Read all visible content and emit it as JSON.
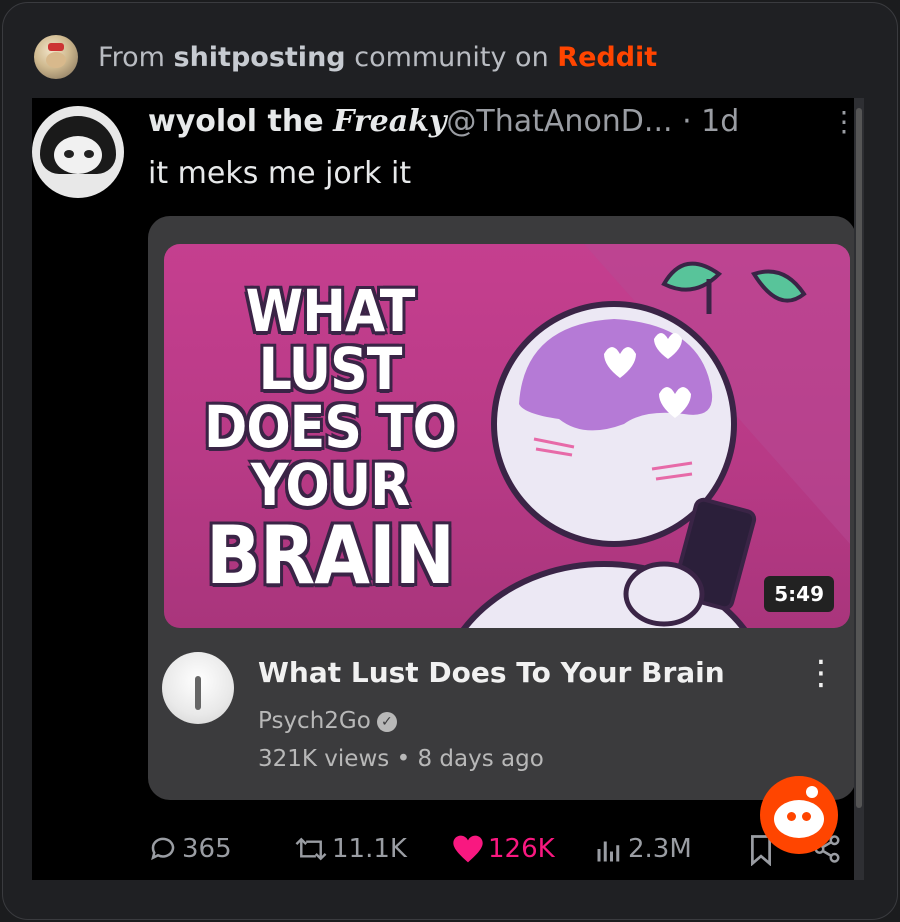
{
  "banner": {
    "prefix": "From",
    "community": "shitposting",
    "middle": "community on",
    "platform": "Reddit"
  },
  "post": {
    "display_name": "wyolol the",
    "display_name_fancy": "Freaky",
    "handle": "@ThatAnonD...",
    "time": "· 1d",
    "text": "it meks me jork it"
  },
  "video": {
    "thumb_lines": [
      "WHAT LUST",
      "DOES TO",
      "YOUR",
      "BRAIN"
    ],
    "duration": "5:49",
    "title": "What Lust Does To Your Brain",
    "channel": "Psych2Go",
    "views": "321K views",
    "age": "8 days ago"
  },
  "actions": {
    "replies": "365",
    "reposts": "11.1K",
    "likes": "126K",
    "views": "2.3M"
  },
  "icons": {
    "reply": "speech-bubble-icon",
    "repost": "repost-arrows-icon",
    "like": "heart-icon",
    "views": "bar-chart-icon",
    "bookmark": "bookmark-icon",
    "share": "share-icon",
    "more": "kebab-icon",
    "verified": "checkmark-badge-icon",
    "reddit": "snoo-icon"
  },
  "colors": {
    "reddit_orange": "#ff4500",
    "like_pink": "#f91880",
    "thumb_magenta": "#c53f8f"
  }
}
